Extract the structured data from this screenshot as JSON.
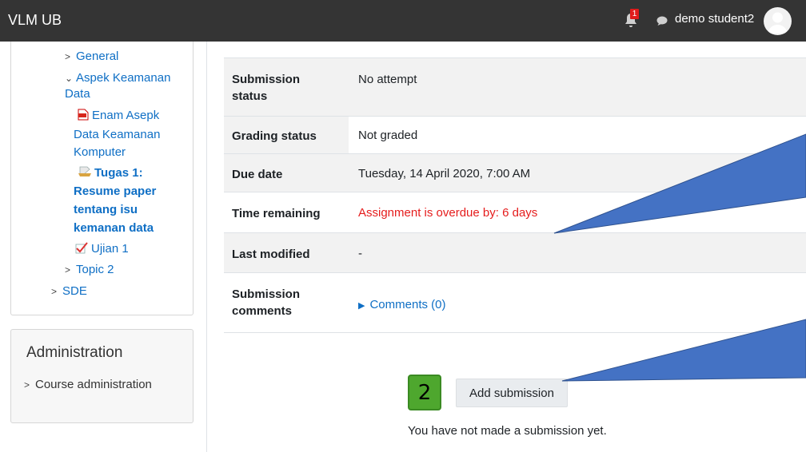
{
  "header": {
    "brand": "VLM UB",
    "notification_count": "1",
    "username": "demo student2"
  },
  "sidebar": {
    "items": [
      {
        "label": "General"
      },
      {
        "label": "Aspek Keamanan"
      },
      {
        "label": "Data"
      },
      {
        "label": "Enam Asepk"
      },
      {
        "label": "Data Keamanan"
      },
      {
        "label": "Komputer"
      },
      {
        "label": "Tugas 1:"
      },
      {
        "label": "Resume paper"
      },
      {
        "label": "tentang isu"
      },
      {
        "label": "kemanan data"
      },
      {
        "label": "Ujian 1"
      },
      {
        "label": "Topic 2"
      },
      {
        "label": "SDE"
      }
    ]
  },
  "administration": {
    "title": "Administration",
    "item": "Course administration"
  },
  "submission": {
    "rows": [
      {
        "label_1": "Submission",
        "label_2": "status",
        "value": "No attempt"
      },
      {
        "label_1": "Grading status",
        "value": "Not graded"
      },
      {
        "label_1": "Due date",
        "value": "Tuesday, 14 April 2020, 7:00 AM"
      },
      {
        "label_1": "Time remaining",
        "value": "Assignment is overdue by: 6 days"
      },
      {
        "label_1": "Last modified",
        "value": "-"
      },
      {
        "label_1": "Submission",
        "label_2": "comments",
        "value": "Comments (0)"
      }
    ],
    "step_number": "2",
    "add_button": "Add submission",
    "note": "You have not made a submission yet."
  },
  "colors": {
    "topbar": "#343434",
    "link": "#0f6fc5",
    "overdue": "#e51c1c",
    "callout": "#4472c4",
    "step_badge": "#4ea72e"
  }
}
